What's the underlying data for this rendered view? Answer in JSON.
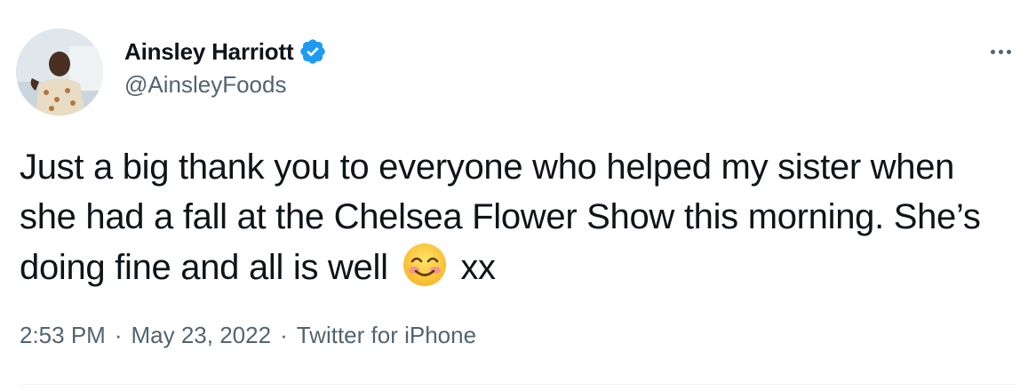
{
  "author": {
    "display_name": "Ainsley Harriott",
    "handle": "@AinsleyFoods",
    "verified": true
  },
  "tweet": {
    "text_before_emoji": "Just a big thank you to everyone who helped my sister when she had a fall at the Chelsea Flower Show this morning. She’s doing fine and all is well ",
    "emoji": "smiling-face-with-smiling-eyes",
    "text_after_emoji": " xx"
  },
  "meta": {
    "time": "2:53 PM",
    "separator_1": "·",
    "date": "May 23, 2022",
    "separator_2": "·",
    "source": "Twitter for iPhone"
  },
  "colors": {
    "text_primary": "#0f1419",
    "text_secondary": "#536471",
    "verified_blue": "#1d9bf0",
    "emoji_yellow": "#ffcc33",
    "divider": "#eff3f4"
  }
}
